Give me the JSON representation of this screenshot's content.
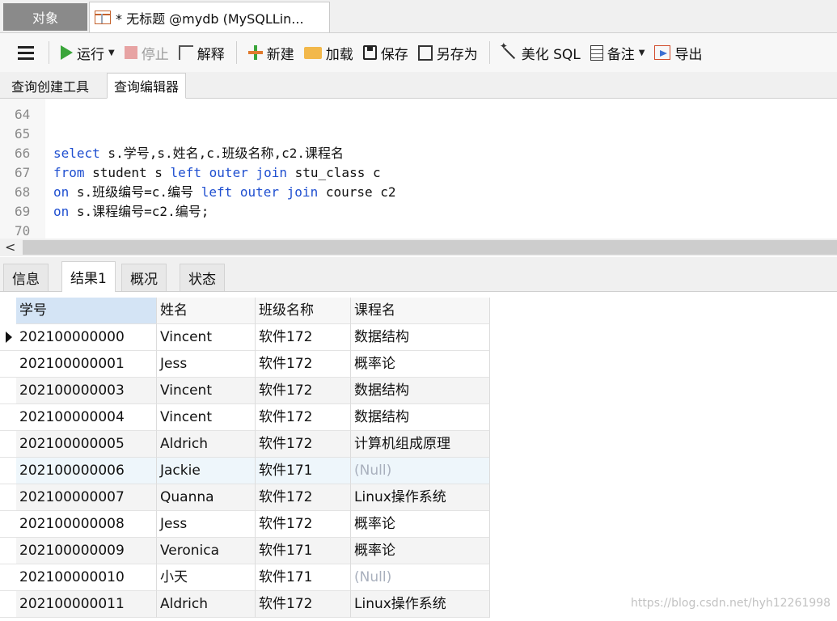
{
  "window_tabs": {
    "objects": "对象",
    "query": "* 无标题 @mydb (MySQLLin..."
  },
  "toolbar": {
    "run": "运行",
    "stop": "停止",
    "explain": "解释",
    "new": "新建",
    "load": "加载",
    "save": "保存",
    "save_as": "另存为",
    "beautify": "美化 SQL",
    "comment": "备注",
    "export": "导出"
  },
  "editor_tabs": {
    "builder": "查询创建工具",
    "editor": "查询编辑器"
  },
  "editor": {
    "lines": [
      {
        "num": "64",
        "tokens": []
      },
      {
        "num": "65",
        "tokens": []
      },
      {
        "num": "66",
        "tokens": [
          {
            "t": "select",
            "kw": true
          },
          {
            "t": " s.学号,s.姓名,c.班级名称,c2.课程名",
            "kw": false
          }
        ]
      },
      {
        "num": "67",
        "tokens": [
          {
            "t": "from",
            "kw": true
          },
          {
            "t": " student s ",
            "kw": false
          },
          {
            "t": "left outer join",
            "kw": true
          },
          {
            "t": " stu_class c",
            "kw": false
          }
        ]
      },
      {
        "num": "68",
        "tokens": [
          {
            "t": "on",
            "kw": true
          },
          {
            "t": " s.班级编号=c.编号 ",
            "kw": false
          },
          {
            "t": "left outer join",
            "kw": true
          },
          {
            "t": " course c2",
            "kw": false
          }
        ]
      },
      {
        "num": "69",
        "tokens": [
          {
            "t": "on",
            "kw": true
          },
          {
            "t": " s.课程编号=c2.编号;",
            "kw": false
          }
        ]
      },
      {
        "num": "70",
        "tokens": []
      }
    ]
  },
  "scroll_arrow": "<",
  "result_tabs": [
    {
      "label": "信息",
      "active": false
    },
    {
      "label": "结果1",
      "active": true
    },
    {
      "label": "概况",
      "active": false
    },
    {
      "label": "状态",
      "active": false
    }
  ],
  "grid": {
    "columns": [
      "学号",
      "姓名",
      "班级名称",
      "课程名"
    ],
    "rows": [
      [
        "202100000000",
        "Vincent",
        "软件172",
        "数据结构"
      ],
      [
        "202100000001",
        "Jess",
        "软件172",
        "概率论"
      ],
      [
        "202100000003",
        "Vincent",
        "软件172",
        "数据结构"
      ],
      [
        "202100000004",
        "Vincent",
        "软件172",
        "数据结构"
      ],
      [
        "202100000005",
        "Aldrich",
        "软件172",
        "计算机组成原理"
      ],
      [
        "202100000006",
        "Jackie",
        "软件171",
        "(Null)"
      ],
      [
        "202100000007",
        "Quanna",
        "软件172",
        "Linux操作系统"
      ],
      [
        "202100000008",
        "Jess",
        "软件172",
        "概率论"
      ],
      [
        "202100000009",
        "Veronica",
        "软件171",
        "概率论"
      ],
      [
        "202100000010",
        "小天",
        "软件171",
        "(Null)"
      ],
      [
        "202100000011",
        "Aldrich",
        "软件172",
        "Linux操作系统"
      ]
    ],
    "current_row": 0,
    "highlighted_row": 5
  },
  "watermark": "https://blog.csdn.net/hyh12261998",
  "colors": {
    "keyword": "#1f4fd0",
    "null": "#a9b0bd",
    "run": "#3aa53a"
  }
}
